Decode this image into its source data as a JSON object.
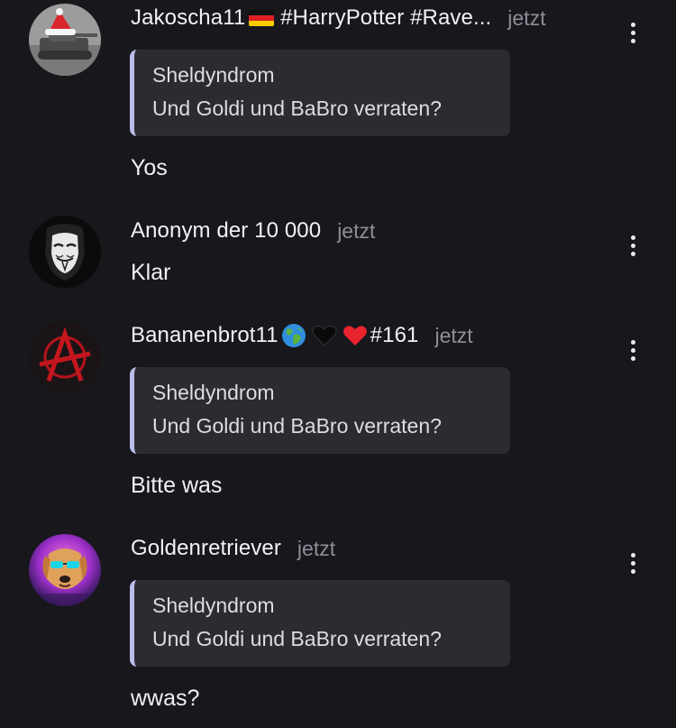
{
  "colors": {
    "background": "#17171c",
    "quote_background": "#2b2b32",
    "quote_accent": "#b9bde8",
    "timestamp": "#8e8e98"
  },
  "messages": [
    {
      "username": "Jakoscha11",
      "username_suffix": " #HarryPotter #Rave...",
      "badge_icon": "germany-flag-icon",
      "time": "jetzt",
      "avatar_icon": "tank-santa-hat-avatar",
      "quote": {
        "author": "Sheldyndrom",
        "text": "Und Goldi und BaBro verraten?"
      },
      "text": "Yos"
    },
    {
      "username": "Anonym der 10 000",
      "time": "jetzt",
      "avatar_icon": "anonymous-mask-avatar",
      "text": "Klar"
    },
    {
      "username": "Bananenbrot11",
      "username_suffix": "#161",
      "badge_icons": [
        "globe-icon",
        "black-heart-icon",
        "red-heart-icon"
      ],
      "time": "jetzt",
      "avatar_icon": "anarchy-symbol-avatar",
      "quote": {
        "author": "Sheldyndrom",
        "text": "Und Goldi und BaBro verraten?"
      },
      "text": "Bitte was"
    },
    {
      "username": "Goldenretriever",
      "time": "jetzt",
      "avatar_icon": "neon-dog-avatar",
      "quote": {
        "author": "Sheldyndrom",
        "text": "Und Goldi und BaBro verraten?"
      },
      "text": "wwas?"
    }
  ]
}
